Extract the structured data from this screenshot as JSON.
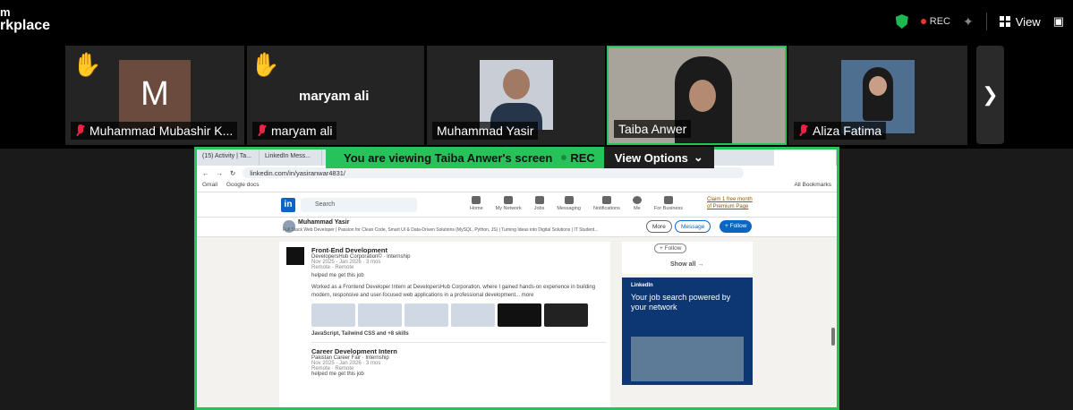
{
  "brand": {
    "line1": "m",
    "line2": "rkplace"
  },
  "topbar": {
    "rec": "REC",
    "view": "View"
  },
  "participants": [
    {
      "name": "Muhammad Mubashir K...",
      "initial": "M",
      "muted": true,
      "hand": true
    },
    {
      "name": "maryam ali",
      "display": "maryam ali",
      "muted": true,
      "hand": true
    },
    {
      "name": "Muhammad Yasir",
      "muted": false
    },
    {
      "name": "Taiba Anwer",
      "muted": false,
      "active": true
    },
    {
      "name": "Aliza Fatima",
      "muted": true
    }
  ],
  "banner": {
    "text": "You are viewing  Taiba Anwer's screen",
    "rec": "REC",
    "options": "View Options"
  },
  "browser": {
    "tabs": [
      "(15) Activity | Ta...",
      "LinkedIn Mess...",
      "",
      "",
      "",
      ""
    ],
    "url": "linkedin.com/in/yasiranwar4831/",
    "bookmarks": [
      "Gmail",
      "Google docs"
    ],
    "all_bookmarks": "All Bookmarks"
  },
  "linkedin": {
    "search": "Search",
    "nav": [
      "Home",
      "My Network",
      "Jobs",
      "Messaging",
      "Notifications",
      "Me",
      "For Business"
    ],
    "premium": "Claim 1 free month of Premium Page",
    "profile_name": "Muhammad Yasir",
    "headline": "Full Stack Web Developer | Passion for Clean Code, Smart UI & Data-Driven Solutions (MySQL, Python, JS) | Turning Ideas into Digital Solutions | IT Student...",
    "more": "More",
    "message": "Message",
    "follow": "+ Follow",
    "follow_small": "+ Follow",
    "show_all": "Show all →",
    "exp1": {
      "title": "Front-End Development",
      "company": "DevelopersHub Corporation© · Internship",
      "dates": "Nov 2025 - Jan 2026 · 3 mos",
      "location": "Remote · Remote",
      "helped": "helped me get this job",
      "desc": "Worked as a Frontend Developer Intern at DevelopersHub Corporation, where I gained hands-on experience in building modern, responsive and user-focused web applications in a professional development... more",
      "skills": "JavaScript, Tailwind CSS and +8 skills"
    },
    "exp2": {
      "title": "Career Development Intern",
      "company": "Pakistan Career Fair · Internship",
      "dates": "Nov 2025 - Jan 2026 · 3 mos",
      "location": "Remote · Remote",
      "helped": "helped me get this job"
    },
    "ad": {
      "brand": "LinkedIn",
      "line": "Your job search powered by your network"
    }
  }
}
